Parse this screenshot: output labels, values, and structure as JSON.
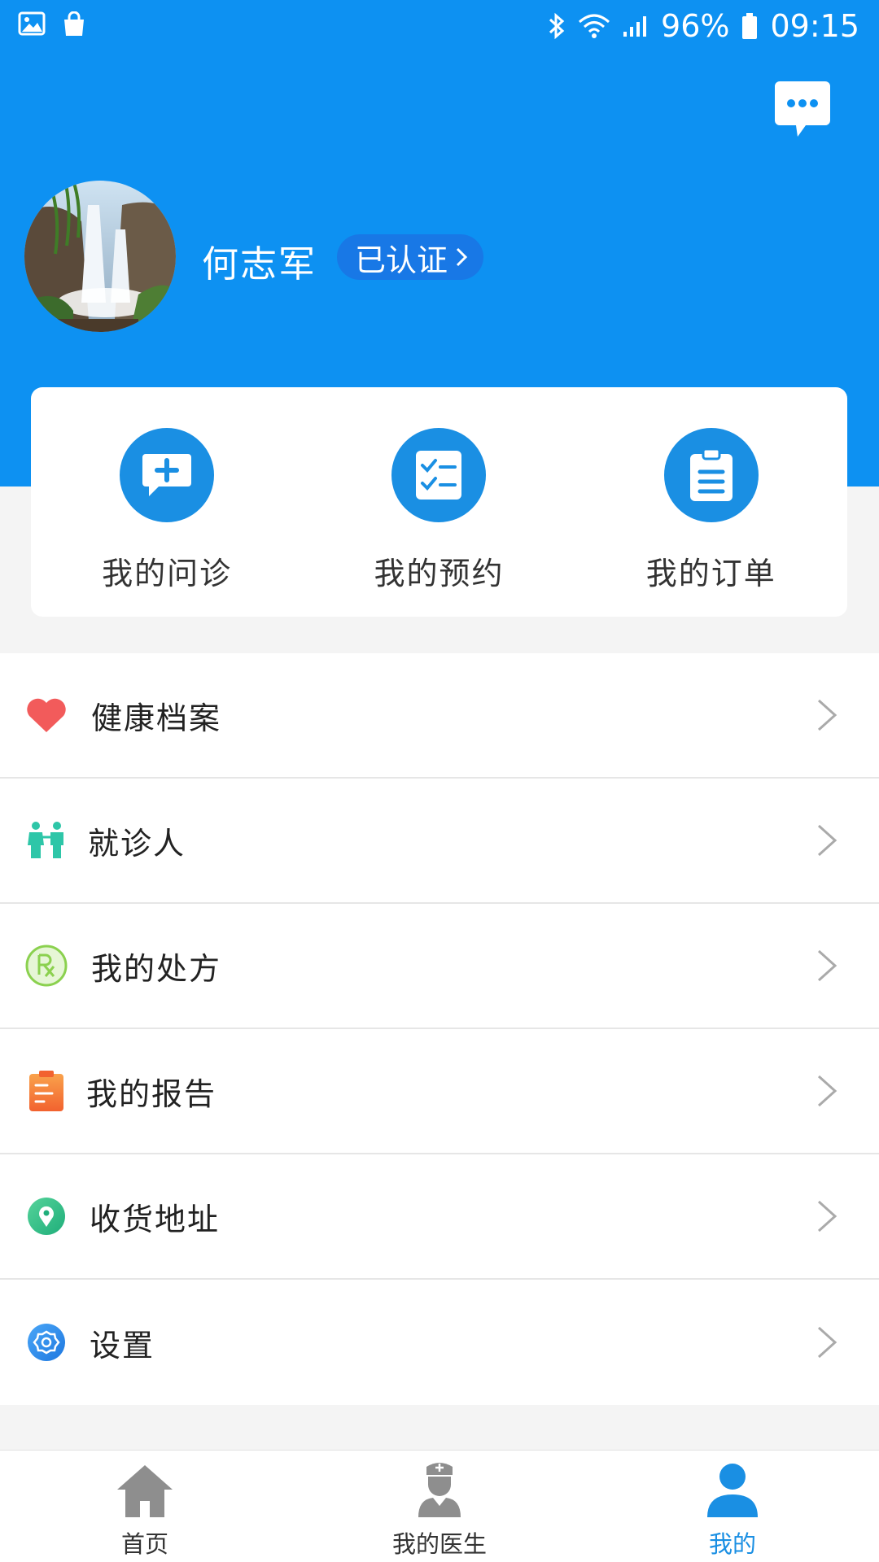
{
  "status_bar": {
    "battery": "96%",
    "time": "09:15"
  },
  "profile": {
    "name": "何志军",
    "verified_label": "已认证"
  },
  "quick_actions": [
    {
      "label": "我的问诊",
      "icon": "medical-chat-icon"
    },
    {
      "label": "我的预约",
      "icon": "checklist-icon"
    },
    {
      "label": "我的订单",
      "icon": "clipboard-icon"
    }
  ],
  "menu": [
    {
      "label": "健康档案",
      "icon": "heart-icon",
      "color": "#f25b5b"
    },
    {
      "label": "就诊人",
      "icon": "family-icon",
      "color": "#2ec6a8"
    },
    {
      "label": "我的处方",
      "icon": "prescription-icon",
      "color": "#8bd14f"
    },
    {
      "label": "我的报告",
      "icon": "report-icon",
      "color": "#f4713a"
    },
    {
      "label": "收货地址",
      "icon": "location-pin-icon",
      "color": "#2fc08e"
    },
    {
      "label": "设置",
      "icon": "settings-icon",
      "color": "#2b8ef0"
    }
  ],
  "bottom_nav": [
    {
      "label": "首页",
      "icon": "home-icon",
      "active": false
    },
    {
      "label": "我的医生",
      "icon": "doctor-icon",
      "active": false
    },
    {
      "label": "我的",
      "icon": "user-icon",
      "active": true
    }
  ],
  "colors": {
    "primary": "#0d91f2",
    "accent_blue": "#1a8fe3",
    "badge": "#1878e6",
    "background": "#f4f4f4"
  }
}
